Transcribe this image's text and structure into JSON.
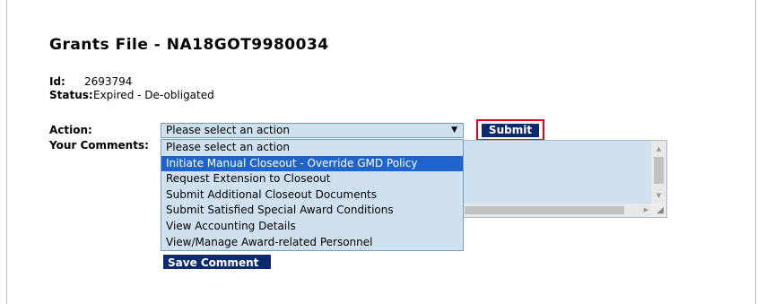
{
  "page": {
    "title": "Grants File - NA18GOT9980034"
  },
  "record": {
    "id_label": "Id:",
    "id_value": "2693794",
    "status_label": "Status:",
    "status_value": "Expired - De-obligated"
  },
  "form": {
    "action_label": "Action:",
    "action_selected": "Please select an action",
    "submit_label": "Submit",
    "comments_label": "Your Comments:",
    "save_label": "Save Comment"
  },
  "dropdown": {
    "options": [
      "Please select an action",
      "Initiate Manual Closeout - Override GMD Policy",
      "Request Extension to Closeout",
      "Submit Additional Closeout Documents",
      "Submit Satisfied Special Award Conditions",
      "View Accounting Details",
      "View/Manage Award-related Personnel"
    ],
    "highlighted_index": 1
  },
  "colors": {
    "button_bg": "#0e2a6e",
    "field_bg": "#cfe0ee",
    "highlight_bg": "#1e64cc",
    "annotation_border": "#e2001a"
  },
  "icons": {
    "select_arrow": "dropdown-arrow-icon",
    "scroll_up": "scroll-up-icon",
    "scroll_down": "scroll-down-icon",
    "scroll_right": "scroll-right-icon",
    "resize": "resize-grip-icon"
  }
}
